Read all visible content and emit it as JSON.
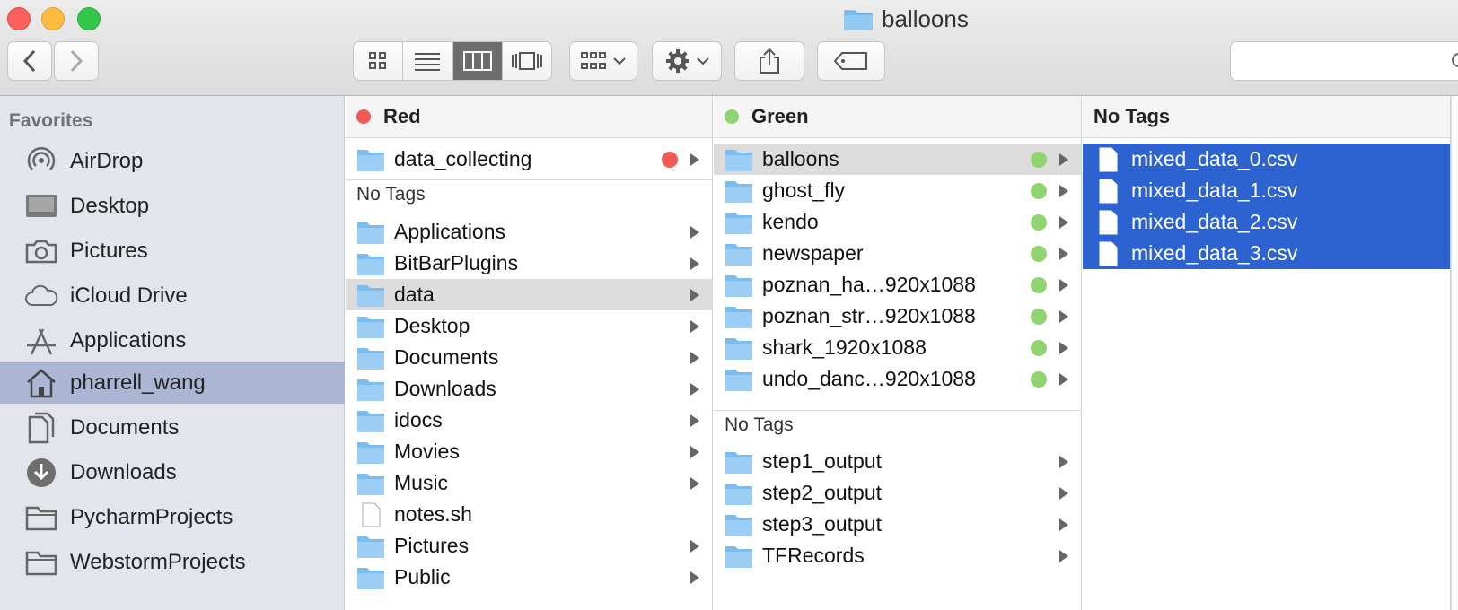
{
  "window": {
    "title": "balloons"
  },
  "toolbar": {
    "back_icon": "chevron-left-icon",
    "forward_icon": "chevron-right-icon",
    "views": [
      "icon-view-icon",
      "list-view-icon",
      "column-view-icon",
      "cover-flow-icon"
    ],
    "active_view": "column-view-icon",
    "group_icon": "arrange-icon",
    "action_icon": "gear-icon",
    "share_icon": "share-icon",
    "tag_icon": "tag-icon"
  },
  "sidebar": {
    "heading": "Favorites",
    "items": [
      {
        "label": "AirDrop",
        "icon": "airdrop-icon"
      },
      {
        "label": "Desktop",
        "icon": "desktop-icon"
      },
      {
        "label": "Pictures",
        "icon": "camera-icon"
      },
      {
        "label": "iCloud Drive",
        "icon": "cloud-icon"
      },
      {
        "label": "Applications",
        "icon": "applications-icon"
      },
      {
        "label": "pharrell_wang",
        "icon": "home-icon",
        "selected": true
      },
      {
        "label": "Documents",
        "icon": "documents-icon"
      },
      {
        "label": "Downloads",
        "icon": "downloads-icon"
      },
      {
        "label": "PycharmProjects",
        "icon": "folder-icon"
      },
      {
        "label": "WebstormProjects",
        "icon": "folder-icon"
      }
    ]
  },
  "col1": {
    "header": "Red",
    "tagged": [
      "data_collecting"
    ],
    "subheader": "No Tags",
    "items": [
      "Applications",
      "BitBarPlugins",
      "data",
      "Desktop",
      "Documents",
      "Downloads",
      "idocs",
      "Movies",
      "Music",
      "notes.sh",
      "Pictures",
      "Public"
    ]
  },
  "col2": {
    "header": "Green",
    "tagged": [
      "balloons",
      "ghost_fly",
      "kendo",
      "newspaper",
      "poznan_ha…920x1088",
      "poznan_str…920x1088",
      "shark_1920x1088",
      "undo_danc…920x1088"
    ],
    "subheader": "No Tags",
    "items": [
      "step1_output",
      "step2_output",
      "step3_output",
      "TFRecords"
    ]
  },
  "col3": {
    "header": "No Tags",
    "items": [
      "mixed_data_0.csv",
      "mixed_data_1.csv",
      "mixed_data_2.csv",
      "mixed_data_3.csv"
    ]
  },
  "colors": {
    "selection": "#2c63d1",
    "red_tag": "#f25a53",
    "green_tag": "#8fd46f",
    "sidebar_sel": "#aab6d3"
  }
}
